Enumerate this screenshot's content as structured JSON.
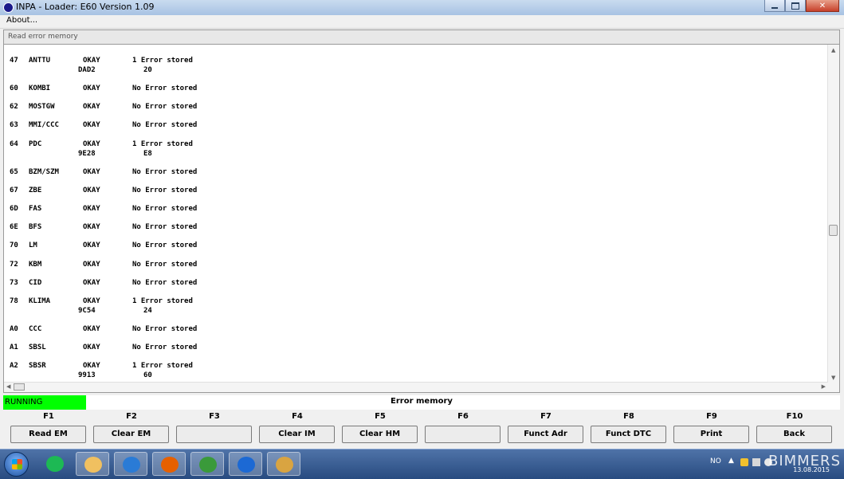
{
  "window": {
    "title": "INPA - Loader:  E60 Version 1.09"
  },
  "menu": {
    "about": "About..."
  },
  "section": {
    "title": "Read error memory"
  },
  "rows": [
    {
      "addr": "47",
      "name": "ANTTU",
      "status": "OKAY",
      "message": "1 Error stored",
      "code": "DAD2",
      "value": "20"
    },
    {
      "addr": "60",
      "name": "KOMBI",
      "status": "OKAY",
      "message": "No Error stored"
    },
    {
      "addr": "62",
      "name": "MOSTGW",
      "status": "OKAY",
      "message": "No Error stored"
    },
    {
      "addr": "63",
      "name": "MMI/CCC",
      "status": "OKAY",
      "message": "No Error stored"
    },
    {
      "addr": "64",
      "name": "PDC",
      "status": "OKAY",
      "message": "1 Error stored",
      "code": "9E28",
      "value": "E8"
    },
    {
      "addr": "65",
      "name": "BZM/SZM",
      "status": "OKAY",
      "message": "No Error stored"
    },
    {
      "addr": "67",
      "name": "ZBE",
      "status": "OKAY",
      "message": "No Error stored"
    },
    {
      "addr": "6D",
      "name": "FAS",
      "status": "OKAY",
      "message": "No Error stored"
    },
    {
      "addr": "6E",
      "name": "BFS",
      "status": "OKAY",
      "message": "No Error stored"
    },
    {
      "addr": "70",
      "name": "LM",
      "status": "OKAY",
      "message": "No Error stored"
    },
    {
      "addr": "72",
      "name": "KBM",
      "status": "OKAY",
      "message": "No Error stored"
    },
    {
      "addr": "73",
      "name": "CID",
      "status": "OKAY",
      "message": "No Error stored"
    },
    {
      "addr": "78",
      "name": "KLIMA",
      "status": "OKAY",
      "message": "1 Error stored",
      "code": "9C54",
      "value": "24"
    },
    {
      "addr": "A0",
      "name": "CCC",
      "status": "OKAY",
      "message": "No Error stored"
    },
    {
      "addr": "A1",
      "name": "SBSL",
      "status": "OKAY",
      "message": "No Error stored"
    },
    {
      "addr": "A2",
      "name": "SBSR",
      "status": "OKAY",
      "message": "1 Error stored",
      "code": "9913",
      "value": "60"
    }
  ],
  "status": {
    "state": "RUNNING",
    "mode": "Error memory"
  },
  "fkeys": [
    {
      "key": "F1",
      "label": "Read EM"
    },
    {
      "key": "F2",
      "label": "Clear EM"
    },
    {
      "key": "F3",
      "label": ""
    },
    {
      "key": "F4",
      "label": "Clear IM"
    },
    {
      "key": "F5",
      "label": "Clear HM"
    },
    {
      "key": "F6",
      "label": ""
    },
    {
      "key": "F7",
      "label": "Funct Adr"
    },
    {
      "key": "F8",
      "label": "Funct DTC"
    },
    {
      "key": "F9",
      "label": "Print"
    },
    {
      "key": "F10",
      "label": "Back"
    }
  ],
  "taskbar": {
    "items": [
      {
        "icon": "spotify-icon",
        "color": "#1db954"
      },
      {
        "icon": "file-explorer-icon",
        "color": "#f0c060"
      },
      {
        "icon": "hp-icon",
        "color": "#2a7bd6"
      },
      {
        "icon": "firefox-icon",
        "color": "#e66000"
      },
      {
        "icon": "ediabas-icon",
        "color": "#3a9a3a"
      },
      {
        "icon": "bmw-icon",
        "color": "#1c69d4"
      },
      {
        "icon": "paint-icon",
        "color": "#d9a441"
      }
    ],
    "language": "NO",
    "watermark": "BIMMERS",
    "date": "13.08.2015"
  },
  "colors": {
    "running": "#00ff00",
    "taskbar": "#284b80"
  }
}
